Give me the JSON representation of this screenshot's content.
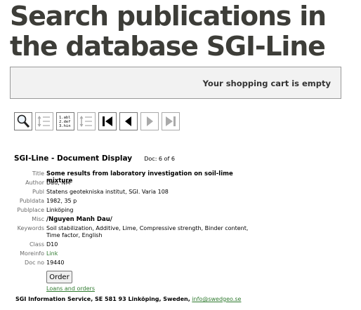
{
  "page": {
    "title": "Search publications in the database SGI-Line"
  },
  "cart": {
    "status": "Your shopping cart is empty"
  },
  "toolbar": {
    "buttons": [
      {
        "icon": "magnifier-icon",
        "enabled": true
      },
      {
        "icon": "alphabetical-list-icon",
        "enabled": false
      },
      {
        "icon": "numbered-list-icon",
        "enabled": true,
        "lines": [
          "1.abl",
          "2.def",
          "3.hin"
        ]
      },
      {
        "icon": "alphabetical-list-icon",
        "enabled": false
      },
      {
        "icon": "first-page-icon",
        "enabled": true
      },
      {
        "icon": "previous-page-icon",
        "enabled": true
      },
      {
        "icon": "next-page-icon",
        "enabled": false
      },
      {
        "icon": "last-page-icon",
        "enabled": false
      }
    ]
  },
  "document": {
    "heading": "SGI-Line - Document Display",
    "counter": "Doc: 6 of 6",
    "fields": [
      {
        "label": "Title",
        "value": "Some results from laboratory investigation on soil-lime mixture"
      },
      {
        "label": "Author",
        "value": "Dau, NM"
      },
      {
        "label": "Publ",
        "value": "Statens geotekniska institut, SGI. Varia 108"
      },
      {
        "label": "Publdata",
        "value": "1982, 35 p"
      },
      {
        "label": "Publplace",
        "value": "Linköping"
      },
      {
        "label": "Misc",
        "value": "/Nguyen Manh Dau/"
      },
      {
        "label": "Keywords",
        "value": "Soil stabilization, Additive, Lime, Compressive strength, Binder content, Time factor, English"
      },
      {
        "label": "Class",
        "value": "D10"
      },
      {
        "label": "Moreinfo",
        "value": "Link"
      },
      {
        "label": "Doc no",
        "value": "19440"
      }
    ]
  },
  "actions": {
    "order_label": "Order",
    "loans_label": "Loans and orders"
  },
  "footer": {
    "text": "SGI Information Service, SE  581 93 Linköping, Sweden,",
    "email": "info@swedgeo.se"
  },
  "colors": {
    "title": "#3d3d38",
    "link": "#2f7a2f",
    "label": "#6b6b6b"
  }
}
